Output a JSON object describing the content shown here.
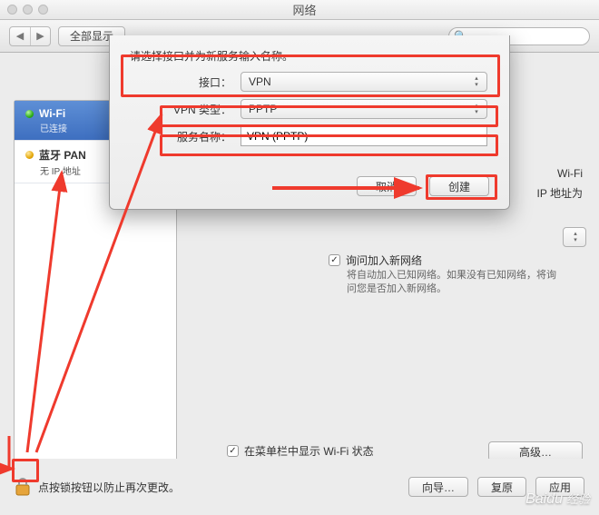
{
  "window": {
    "title": "网络"
  },
  "toolbar": {
    "show_all": "全部显示",
    "search_placeholder": ""
  },
  "sidebar": {
    "items": [
      {
        "name": "Wi-Fi",
        "sub": "已连接",
        "status": "green",
        "selected": true
      },
      {
        "name": "蓝牙 PAN",
        "sub": "无 IP 地址",
        "status": "yellow",
        "selected": false
      }
    ],
    "add": "+",
    "remove": "−",
    "gear": "✻▾"
  },
  "right": {
    "network_name_label": "Wi-Fi",
    "network_name_note": "IP 地址为",
    "ask_join_label": "询问加入新网络",
    "ask_join_help": "将自动加入已知网络。如果没有已知网络，将询问您是否加入新网络。",
    "menubar_label": "在菜单栏中显示 Wi-Fi 状态",
    "advanced": "高级…"
  },
  "sheet": {
    "prompt": "请选择接口并为新服务输入名称。",
    "interface_label": "接口：",
    "interface_value": "VPN",
    "vpn_type_label": "VPN 类型：",
    "vpn_type_value": "PPTP",
    "service_name_label": "服务名称：",
    "service_name_value": "VPN (PPTP)",
    "cancel": "取消",
    "create": "创建"
  },
  "bottom": {
    "lock_text": "点按锁按钮以防止再次更改。",
    "assistant": "向导…",
    "revert": "复原",
    "apply": "应用"
  },
  "watermark": {
    "brand": "Baidu",
    "sub": "经验"
  }
}
